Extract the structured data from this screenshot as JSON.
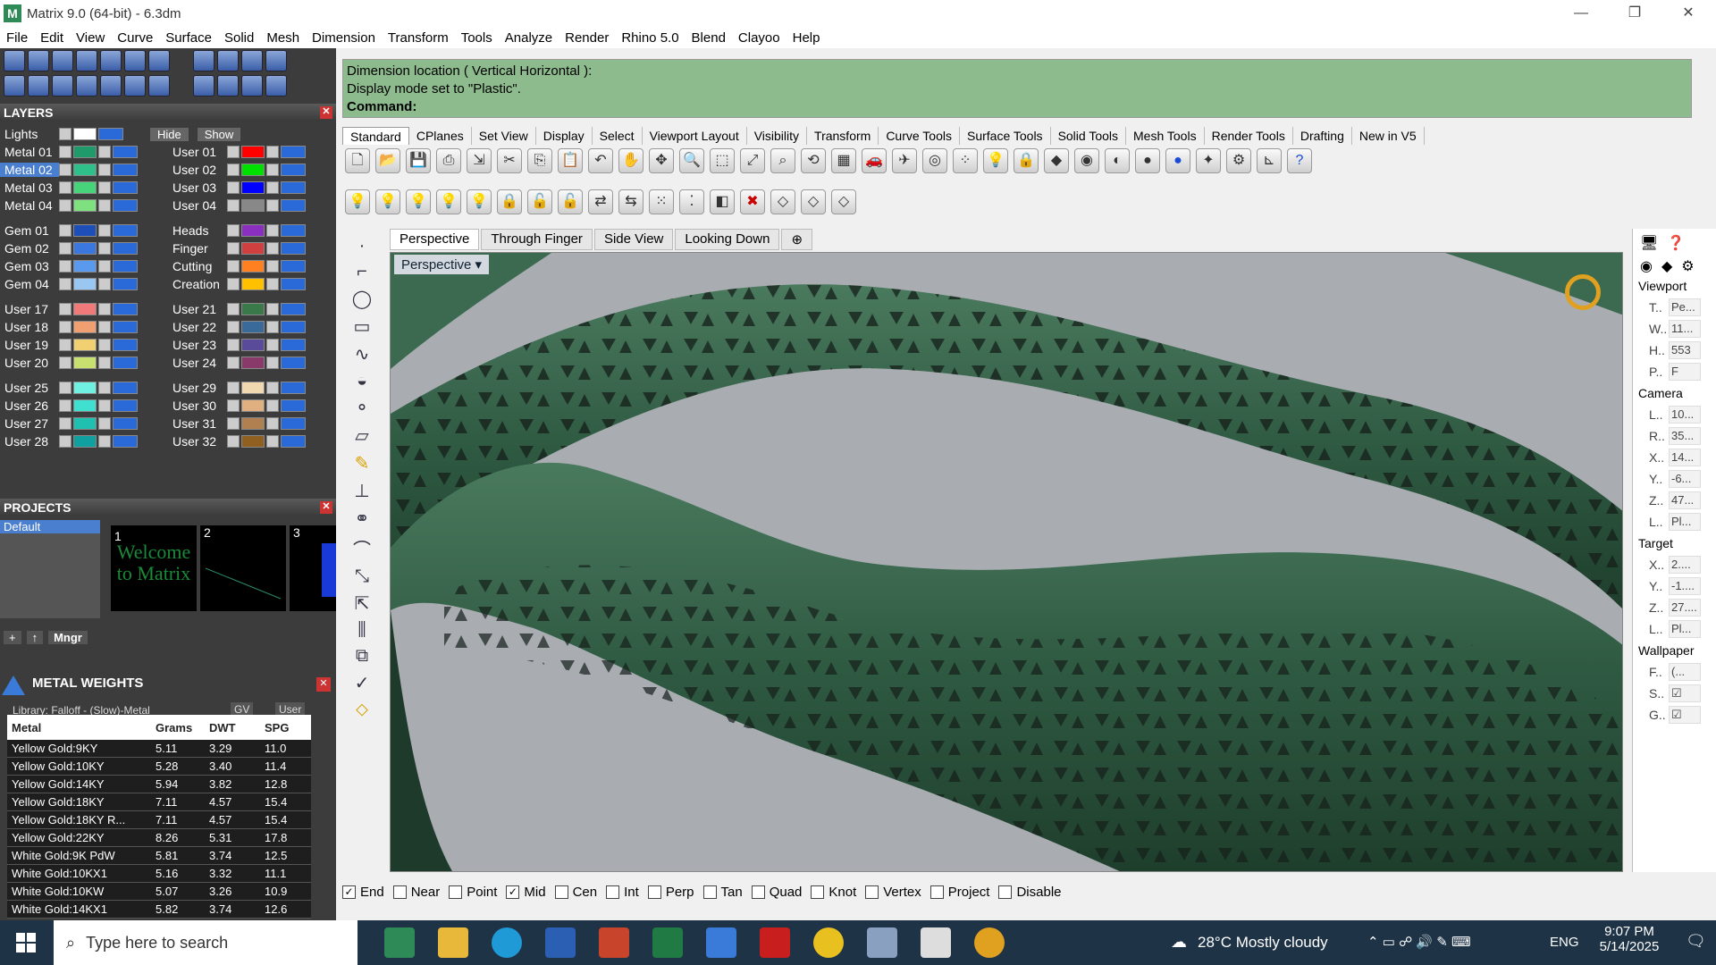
{
  "window": {
    "title": "Matrix 9.0 (64-bit) - 6.3dm"
  },
  "menu": [
    "File",
    "Edit",
    "View",
    "Curve",
    "Surface",
    "Solid",
    "Mesh",
    "Dimension",
    "Transform",
    "Tools",
    "Analyze",
    "Render",
    "Rhino 5.0",
    "Blend",
    "Clayoo",
    "Help"
  ],
  "layers": {
    "title": "LAYERS",
    "lights_label": "Lights",
    "hide_label": "Hide",
    "show_label": "Show",
    "left": [
      {
        "name": "Metal 01",
        "color": "#1f9a6a"
      },
      {
        "name": "Metal 02",
        "color": "#2fbf8a",
        "selected": true
      },
      {
        "name": "Metal 03",
        "color": "#46d37a"
      },
      {
        "name": "Metal 04",
        "color": "#7ee07e"
      },
      {
        "name": "Gem 01",
        "color": "#1e4fb8"
      },
      {
        "name": "Gem 02",
        "color": "#3a78e0"
      },
      {
        "name": "Gem 03",
        "color": "#5a9aee"
      },
      {
        "name": "Gem 04",
        "color": "#9ac6f2"
      },
      {
        "name": "User 17",
        "color": "#f07a7a"
      },
      {
        "name": "User 18",
        "color": "#f0a070"
      },
      {
        "name": "User 19",
        "color": "#f0d070"
      },
      {
        "name": "User 20",
        "color": "#c8e070"
      },
      {
        "name": "User 25",
        "color": "#70f0e0"
      },
      {
        "name": "User 26",
        "color": "#40e0d0"
      },
      {
        "name": "User 27",
        "color": "#20c0b0"
      },
      {
        "name": "User 28",
        "color": "#10a0a0"
      }
    ],
    "right": [
      {
        "name": "User 01",
        "color": "#ff0000"
      },
      {
        "name": "User 02",
        "color": "#00e000"
      },
      {
        "name": "User 03",
        "color": "#0000ff"
      },
      {
        "name": "User 04",
        "color": "#888888"
      },
      {
        "name": "Heads",
        "color": "#8a2fc0"
      },
      {
        "name": "Finger",
        "color": "#d04040"
      },
      {
        "name": "Cutting",
        "color": "#ff8020"
      },
      {
        "name": "Creation",
        "color": "#ffc000"
      },
      {
        "name": "User 21",
        "color": "#3a7a4a"
      },
      {
        "name": "User 22",
        "color": "#3a6a9a"
      },
      {
        "name": "User 23",
        "color": "#5a4a9a"
      },
      {
        "name": "User 24",
        "color": "#8a3a6a"
      },
      {
        "name": "User 29",
        "color": "#f2d8b0"
      },
      {
        "name": "User 30",
        "color": "#e0b080"
      },
      {
        "name": "User 31",
        "color": "#b08050"
      },
      {
        "name": "User 32",
        "color": "#906020"
      }
    ]
  },
  "projects": {
    "title": "PROJECTS",
    "default_label": "Default",
    "thumb1_text": "Welcome to Matrix",
    "thumb_numbers": [
      "1",
      "2",
      "3"
    ],
    "mngr_label": "Mngr"
  },
  "metal_weights": {
    "title": "METAL WEIGHTS",
    "library": "Library: Falloff - (Slow)-Metal",
    "gv_label": "GV",
    "user_label": "User",
    "columns": [
      "Metal",
      "Grams",
      "DWT",
      "SPG"
    ],
    "rows": [
      [
        "Yellow Gold:9KY",
        "5.11",
        "3.29",
        "11.0"
      ],
      [
        "Yellow Gold:10KY",
        "5.28",
        "3.40",
        "11.4"
      ],
      [
        "Yellow Gold:14KY",
        "5.94",
        "3.82",
        "12.8"
      ],
      [
        "Yellow Gold:18KY",
        "7.11",
        "4.57",
        "15.4"
      ],
      [
        "Yellow Gold:18KY R...",
        "7.11",
        "4.57",
        "15.4"
      ],
      [
        "Yellow Gold:22KY",
        "8.26",
        "5.31",
        "17.8"
      ],
      [
        "White Gold:9K PdW",
        "5.81",
        "3.74",
        "12.5"
      ],
      [
        "White Gold:10KX1",
        "5.16",
        "3.32",
        "11.1"
      ],
      [
        "White Gold:10KW",
        "5.07",
        "3.26",
        "10.9"
      ],
      [
        "White Gold:14KX1",
        "5.82",
        "3.74",
        "12.6"
      ]
    ]
  },
  "command": {
    "line1": "Dimension location ( Vertical  Horizontal ):",
    "line2": "Display mode set to \"Plastic\".",
    "prompt": "Command:"
  },
  "toolbar_tabs": [
    "Standard",
    "CPlanes",
    "Set View",
    "Display",
    "Select",
    "Viewport Layout",
    "Visibility",
    "Transform",
    "Curve Tools",
    "Surface Tools",
    "Solid Tools",
    "Mesh Tools",
    "Render Tools",
    "Drafting",
    "New in V5"
  ],
  "viewport_tabs": [
    "Perspective",
    "Through Finger",
    "Side View",
    "Looking Down"
  ],
  "viewport": {
    "label": "Perspective"
  },
  "properties": {
    "viewport_header": "Viewport",
    "viewport_rows": [
      [
        "T..",
        "Pe..."
      ],
      [
        "W..",
        "11..."
      ],
      [
        "H..",
        "553"
      ],
      [
        "P..",
        "F"
      ]
    ],
    "camera_header": "Camera",
    "camera_rows": [
      [
        "L..",
        "10..."
      ],
      [
        "R..",
        "35..."
      ],
      [
        "X..",
        "14..."
      ],
      [
        "Y..",
        "-6..."
      ],
      [
        "Z..",
        "47..."
      ],
      [
        "L..",
        "Pl..."
      ]
    ],
    "target_header": "Target",
    "target_rows": [
      [
        "X..",
        "2...."
      ],
      [
        "Y..",
        "-1...."
      ],
      [
        "Z..",
        "27...."
      ],
      [
        "L..",
        "Pl..."
      ]
    ],
    "wallpaper_header": "Wallpaper",
    "wallpaper_rows": [
      [
        "F..",
        "(..."
      ],
      [
        "S..",
        "☑"
      ],
      [
        "G..",
        "☑"
      ]
    ]
  },
  "osnaps": [
    {
      "label": "End",
      "checked": true
    },
    {
      "label": "Near",
      "checked": false
    },
    {
      "label": "Point",
      "checked": false
    },
    {
      "label": "Mid",
      "checked": true
    },
    {
      "label": "Cen",
      "checked": false
    },
    {
      "label": "Int",
      "checked": false
    },
    {
      "label": "Perp",
      "checked": false
    },
    {
      "label": "Tan",
      "checked": false
    },
    {
      "label": "Quad",
      "checked": false
    },
    {
      "label": "Knot",
      "checked": false
    },
    {
      "label": "Vertex",
      "checked": false
    },
    {
      "label": "Project",
      "checked": false
    },
    {
      "label": "Disable",
      "checked": false
    }
  ],
  "taskbar": {
    "search_placeholder": "Type here to search",
    "weather": "28°C  Mostly cloudy",
    "lang": "ENG",
    "time": "9:07 PM",
    "date": "5/14/2025"
  }
}
